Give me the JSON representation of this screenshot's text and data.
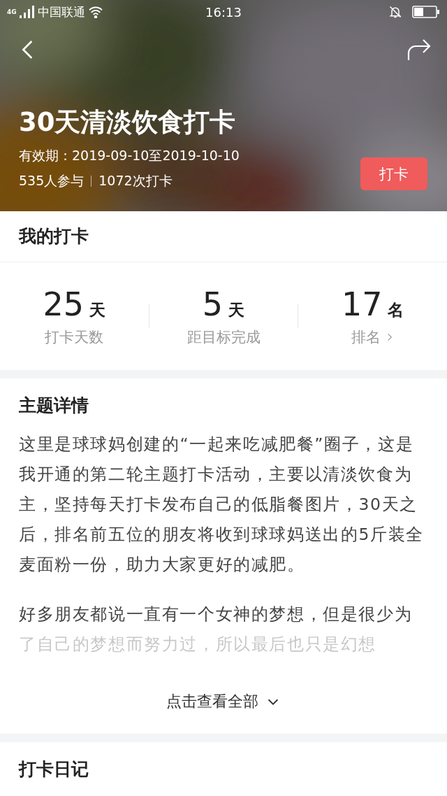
{
  "status_bar": {
    "network": "4G",
    "carrier": "中国联通",
    "time": "16:13"
  },
  "header": {
    "title": "30天清淡饮食打卡",
    "validity": "有效期：2019-09-10至2019-10-10",
    "participants": "535人参与",
    "checkins": "1072次打卡",
    "checkin_button": "打卡"
  },
  "my_checkin": {
    "title": "我的打卡",
    "stats": [
      {
        "value": "25",
        "unit": "天",
        "label": "打卡天数",
        "link": false
      },
      {
        "value": "5",
        "unit": "天",
        "label": "距目标完成",
        "link": false
      },
      {
        "value": "17",
        "unit": "名",
        "label": "排名",
        "link": true
      }
    ]
  },
  "details": {
    "title": "主题详情",
    "paragraphs": [
      {
        "text": "这里是球球妈创建的“一起来吃减肥餐”圈子，这是我开通的第二轮主题打卡活动，主要以清淡饮食为主，坚持每天打卡发布自己的低脂餐图片，30天之后，排名前五位的朋友将收到球球妈送出的5斤装全麦面粉一份，助力大家更好的减肥。",
        "faded": false
      },
      {
        "text": "好多朋友都说一直有一个女神的梦想，但是很少为了自己的梦想而努力过，所以最后也只是幻想",
        "faded": true
      }
    ],
    "expand": "点击查看全部"
  },
  "diary": {
    "title": "打卡日记"
  }
}
